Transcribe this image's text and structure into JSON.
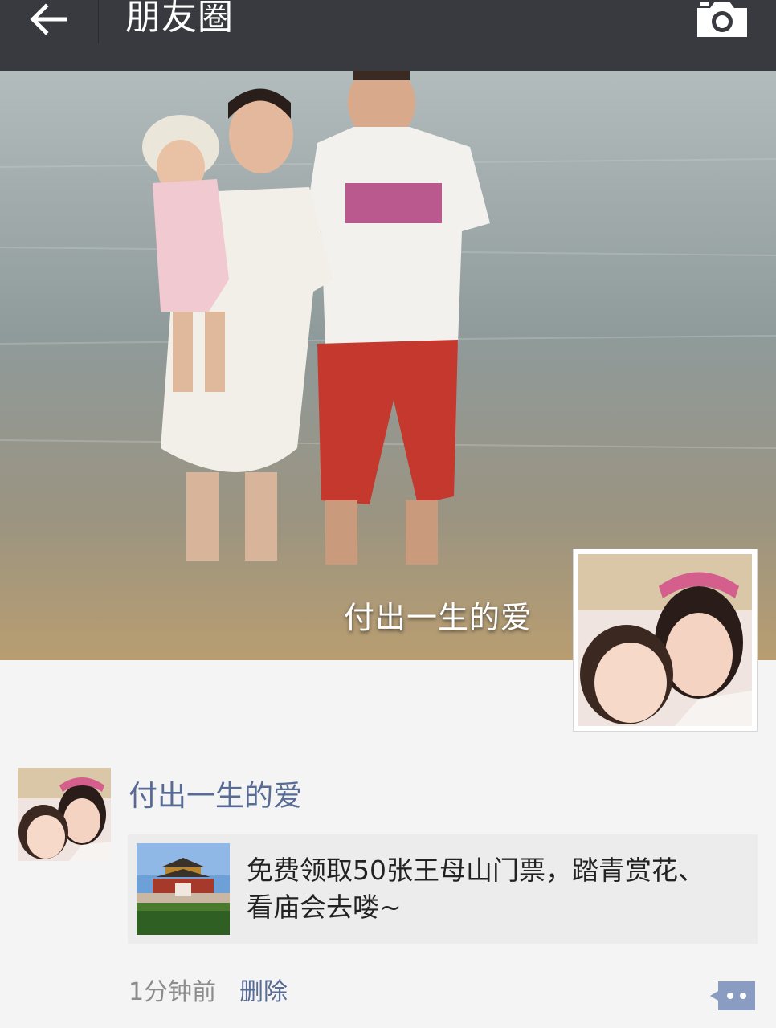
{
  "header": {
    "title": "朋友圈",
    "back_icon": "arrow-left-icon",
    "camera_icon": "camera-icon"
  },
  "cover": {
    "name": "付出一生的爱"
  },
  "post": {
    "author": "付出一生的爱",
    "share": {
      "text": "免费领取50张王母山门票，踏青赏花、看庙会去喽~"
    },
    "time": "1分钟前",
    "delete_label": "删除",
    "comment_icon": "comment-bubble-icon"
  },
  "colors": {
    "topbar": "#393a3f",
    "link": "#576b95",
    "card": "#ececec",
    "background": "#f4f4f4"
  }
}
